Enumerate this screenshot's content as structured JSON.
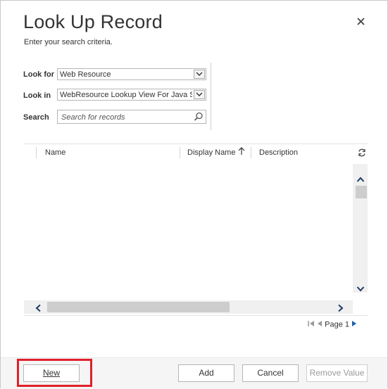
{
  "dialog": {
    "title": "Look Up Record",
    "subtitle": "Enter your search criteria.",
    "close_icon": "close-icon"
  },
  "form": {
    "look_for_label": "Look for",
    "look_for_value": "Web Resource",
    "look_in_label": "Look in",
    "look_in_value": "WebResource Lookup View For Java Sc",
    "search_label": "Search",
    "search_placeholder": "Search for records"
  },
  "grid": {
    "columns": [
      "Name",
      "Display Name",
      "Description"
    ],
    "sort_column": "Display Name",
    "sort_direction": "ascending",
    "refresh_icon": "refresh-icon"
  },
  "pager": {
    "page_label": "Page 1"
  },
  "footer": {
    "new_label": "New",
    "add_label": "Add",
    "cancel_label": "Cancel",
    "remove_label": "Remove Value"
  },
  "colors": {
    "highlight": "#e0202a",
    "accent": "#1a5fb4"
  }
}
